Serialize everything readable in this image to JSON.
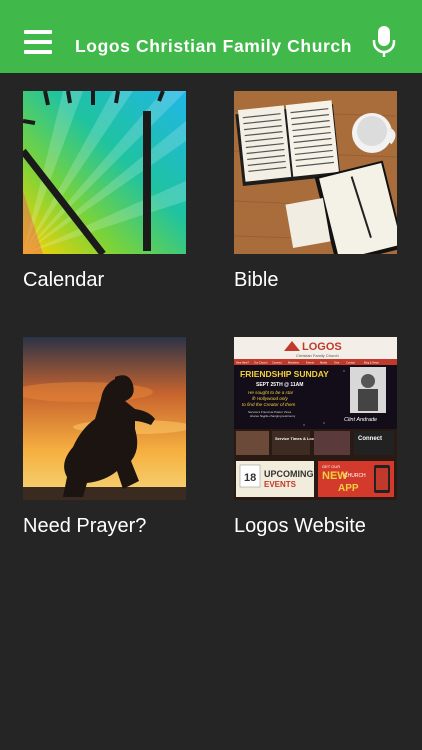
{
  "header": {
    "title": "Logos Christian Family Church",
    "menu_icon": "hamburger-menu-icon",
    "mic_icon": "microphone-icon",
    "background_color": "#41b94a"
  },
  "tiles": [
    {
      "label": "Calendar",
      "image": "calendar-clock-thumbnail"
    },
    {
      "label": "Bible",
      "image": "bible-notebook-thumbnail"
    },
    {
      "label": "Need Prayer?",
      "image": "prayer-silhouette-thumbnail"
    },
    {
      "label": "Logos Website",
      "image": "logos-website-thumbnail"
    }
  ],
  "website_thumb": {
    "logo": "LOGOS",
    "logo_sub": "Christian Family Church",
    "nav": [
      "New Here?",
      "Our Church",
      "Connect",
      "Ministries",
      "Events",
      "Media",
      "Give",
      "Contact",
      "Blog & News"
    ],
    "banner_title": "FRIENDSHIP SUNDAY",
    "banner_date": "SEPT 25TH @ 11AM",
    "banner_text": [
      "He sought to be a star",
      "in Hollywood only",
      "to find the Creator of them"
    ],
    "banner_small": [
      "Service's Friend as Pastor Vines",
      "shares his life-changing testimony"
    ],
    "banner_name": "Clint Andrade",
    "boxes": [
      "Service Times & Location",
      "Connect"
    ],
    "upcoming_num": "18",
    "upcoming_text": [
      "UPCOMING",
      "EVENTS"
    ],
    "app_top": "GET OUR",
    "app_new": "NEW",
    "app_church": "CHURCH",
    "app_word": "APP"
  }
}
